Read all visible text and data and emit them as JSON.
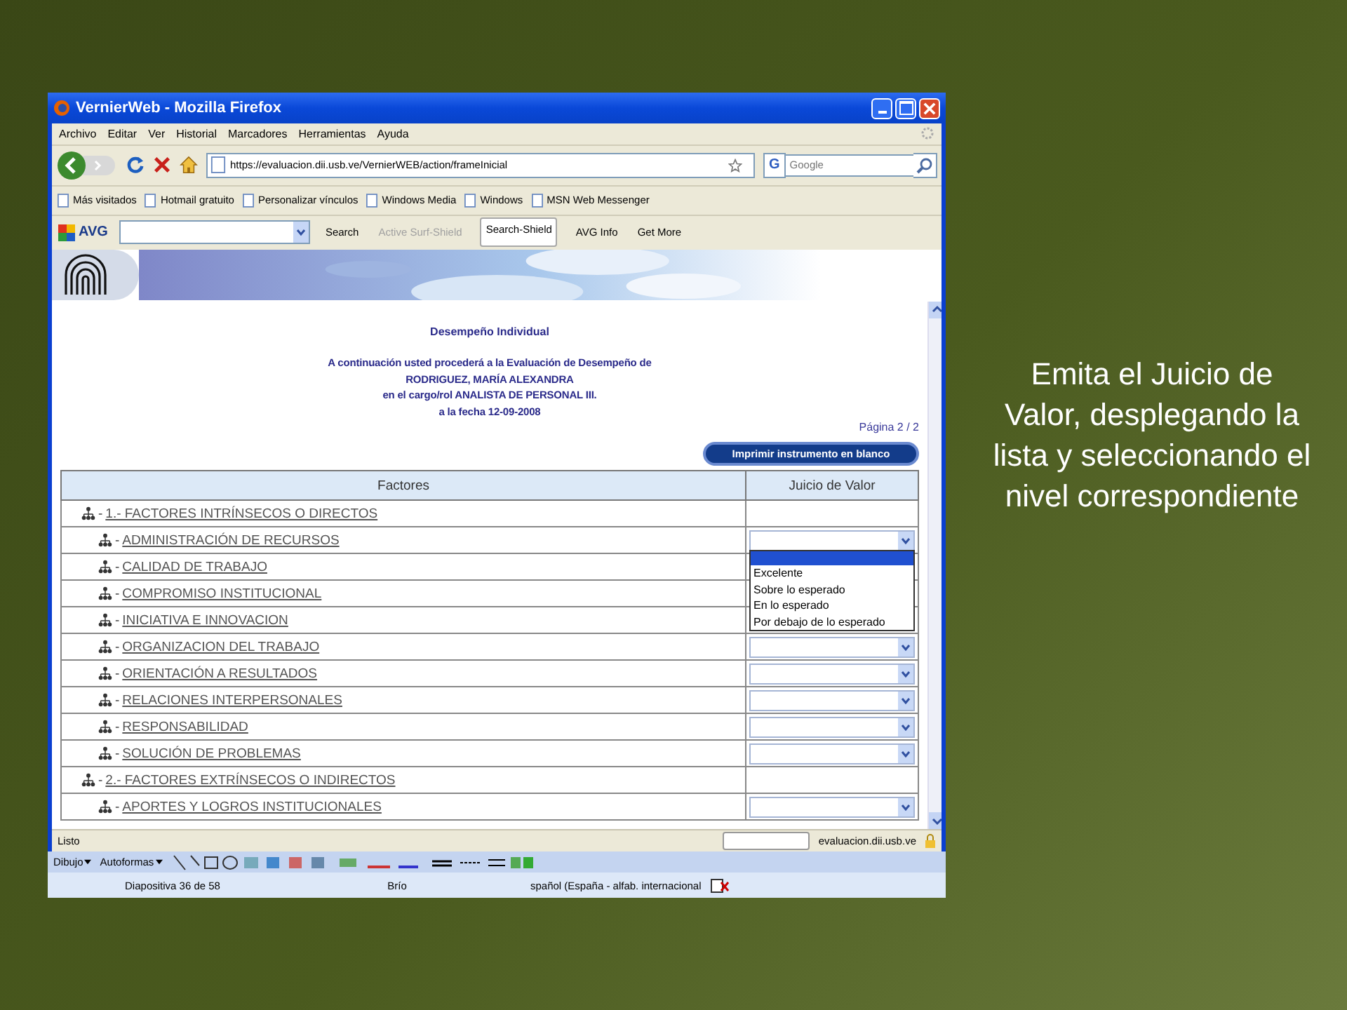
{
  "browser": {
    "title": "VernierWeb - Mozilla Firefox",
    "menu": [
      "Archivo",
      "Editar",
      "Ver",
      "Historial",
      "Marcadores",
      "Herramientas",
      "Ayuda"
    ],
    "url": "https://evaluacion.dii.usb.ve/VernierWEB/action/frameInicial",
    "search_placeholder": "Google",
    "search_engine_label": "G",
    "bookmarks": [
      "Más visitados",
      "Hotmail gratuito",
      "Personalizar vínculos",
      "Windows Media",
      "Windows",
      "MSN Web Messenger"
    ],
    "avg_toolbar": [
      {
        "label": "Search",
        "disabled": false,
        "selected": false
      },
      {
        "label": "Active Surf-Shield",
        "disabled": true,
        "selected": false
      },
      {
        "label": "Search-Shield",
        "disabled": false,
        "selected": true
      },
      {
        "label": "AVG Info",
        "disabled": false,
        "selected": false
      },
      {
        "label": "Get More",
        "disabled": false,
        "selected": false
      }
    ],
    "avg_label": "AVG",
    "status": "Listo",
    "status_domain": "evaluacion.dii.usb.ve"
  },
  "page": {
    "heading": "Desempeño Individual",
    "intro_lines": [
      "A continuación usted procederá a la Evaluación de Desempeño de",
      "RODRIGUEZ, MARÍA ALEXANDRA",
      "en el cargo/rol ANALISTA DE PERSONAL III.",
      "a la fecha 12-09-2008"
    ],
    "pagination": "Página 2 / 2",
    "print_button": "Imprimir instrumento en blanco",
    "table": {
      "columns": [
        "Factores",
        "Juicio de Valor"
      ],
      "separator": "-",
      "rows": [
        {
          "kind": "group",
          "label": "1.- FACTORES INTRÍNSECOS O DIRECTOS",
          "select": false
        },
        {
          "kind": "item",
          "label": "ADMINISTRACIÓN DE RECURSOS",
          "select": true,
          "dropdown_open": true
        },
        {
          "kind": "item",
          "label": "CALIDAD DE TRABAJO"
        },
        {
          "kind": "item",
          "label": "COMPROMISO INSTITUCIONAL"
        },
        {
          "kind": "item",
          "label": "INICIATIVA E INNOVACION"
        },
        {
          "kind": "item",
          "label": "ORGANIZACION DEL TRABAJO",
          "select": true
        },
        {
          "kind": "item",
          "label": "ORIENTACIÓN A RESULTADOS",
          "select": true
        },
        {
          "kind": "item",
          "label": "RELACIONES INTERPERSONALES",
          "select": true
        },
        {
          "kind": "item",
          "label": "RESPONSABILIDAD",
          "select": true
        },
        {
          "kind": "item",
          "label": "SOLUCIÓN DE PROBLEMAS",
          "select": true
        },
        {
          "kind": "group",
          "label": "2.- FACTORES EXTRÍNSECOS O INDIRECTOS",
          "select": false
        },
        {
          "kind": "item",
          "label": "APORTES Y LOGROS INSTITUCIONALES",
          "select": true
        }
      ]
    },
    "dropdown": {
      "blank_highlighted": true,
      "options": [
        "Excelente",
        "Sobre lo esperado",
        "En lo esperado",
        "Por debajo de lo esperado"
      ]
    }
  },
  "powerpoint": {
    "toolbar": [
      "Dibujo",
      "Autoformas"
    ],
    "status": [
      "Diapositiva 36 de 58",
      "Brío",
      "spañol (España - alfab. internacional"
    ]
  },
  "slide_text_lines": [
    "Emita el Juicio de",
    "Valor, desplegando la",
    "lista y seleccionando el",
    "nivel correspondiente"
  ]
}
